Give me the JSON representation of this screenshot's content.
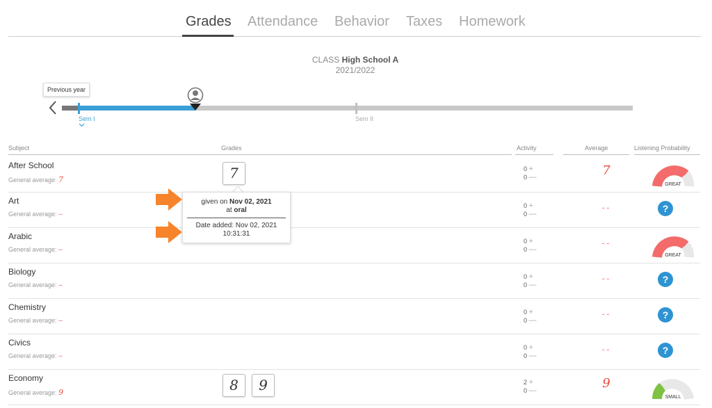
{
  "tabs": [
    "Grades",
    "Attendance",
    "Behavior",
    "Taxes",
    "Homework"
  ],
  "class_info": {
    "prefix": "CLASS",
    "name": "High School A",
    "year": "2021/2022"
  },
  "timeline": {
    "previous_year_tooltip": "Previous year",
    "semesters": [
      "Sem I",
      "Sem II"
    ],
    "colors": {
      "active": "#3a9fd6",
      "inactive": "#c8c8c8"
    }
  },
  "headers": {
    "subject": "Subject",
    "grades": "Grades",
    "activity": "Activity",
    "average": "Average",
    "listening": "Listening Probability"
  },
  "general_average_label": "General average:",
  "rows": [
    {
      "subject": "After School",
      "general": "7",
      "grades": [
        "7"
      ],
      "activity_plus": "0",
      "activity_minus": "0",
      "average": "7",
      "listening": "GREAT"
    },
    {
      "subject": "Art",
      "general": "--",
      "grades": [],
      "activity_plus": "0",
      "activity_minus": "0",
      "average": "--",
      "listening": "?"
    },
    {
      "subject": "Arabic",
      "general": "--",
      "grades": [],
      "activity_plus": "0",
      "activity_minus": "0",
      "average": "--",
      "listening": "GREAT"
    },
    {
      "subject": "Biology",
      "general": "--",
      "grades": [],
      "activity_plus": "0",
      "activity_minus": "0",
      "average": "--",
      "listening": "?"
    },
    {
      "subject": "Chemistry",
      "general": "--",
      "grades": [],
      "activity_plus": "0",
      "activity_minus": "0",
      "average": "--",
      "listening": "?"
    },
    {
      "subject": "Civics",
      "general": "--",
      "grades": [],
      "activity_plus": "0",
      "activity_minus": "0",
      "average": "--",
      "listening": "?"
    },
    {
      "subject": "Economy",
      "general": "9",
      "grades": [
        "8",
        "9"
      ],
      "activity_plus": "2",
      "activity_minus": "0",
      "average": "9",
      "listening": "SMALL"
    }
  ],
  "activity_signs": {
    "plus": "+",
    "minus": "—"
  },
  "tooltip": {
    "given_on": "given on",
    "date": "Nov 02, 2021",
    "at": "at",
    "type": "oral",
    "added": "Date added: Nov 02, 2021",
    "time": "10:31:31"
  },
  "icons": {
    "prev": "chevron-left-icon",
    "student": "user-pin-icon",
    "sem": "chevron-down-icon",
    "unknown": "question-icon",
    "arrow": "orange-arrow-icon"
  }
}
